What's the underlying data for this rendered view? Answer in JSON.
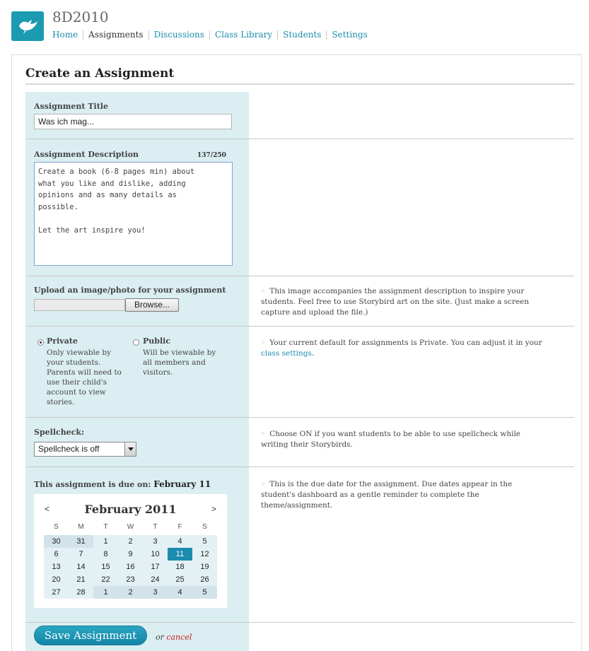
{
  "header": {
    "class_title": "8D2010",
    "nav": [
      {
        "label": "Home",
        "current": false
      },
      {
        "label": "Assignments",
        "current": true
      },
      {
        "label": "Discussions",
        "current": false
      },
      {
        "label": "Class Library",
        "current": false
      },
      {
        "label": "Students",
        "current": false
      },
      {
        "label": "Settings",
        "current": false
      }
    ]
  },
  "page_title": "Create an Assignment",
  "form": {
    "title_label": "Assignment Title",
    "title_value": "Was ich mag...",
    "desc_label": "Assignment Description",
    "desc_counter": "137/250",
    "desc_value": "Create a book (6-8 pages min) about\nwhat you like and dislike, adding\nopinions and as many details as\npossible.\n\nLet the art inspire you!",
    "upload_label": "Upload an image/photo for your assignment",
    "browse_label": "Browse...",
    "upload_help": "This image accompanies the assignment description to inspire your students. Feel free to use Storybird art on the site. (Just make a screen capture and upload the file.)",
    "private_title": "Private",
    "private_desc": "Only viewable by your students. Parents will need to use their child's account to view stories.",
    "public_title": "Public",
    "public_desc": "Will be viewable by all members and visitors.",
    "privacy_help_prefix": "Your current default for assignments is Private. You can adjust it in your",
    "privacy_help_link": "class settings",
    "privacy_help_suffix": ".",
    "spell_label": "Spellcheck:",
    "spell_value": "Spellcheck is off",
    "spell_help": "Choose ON if you want students to be able to use spellcheck while writing their Storybirds.",
    "due_prefix": "This assignment is due on:",
    "due_date": "February 11",
    "due_help": "This is the due date for the assignment. Due dates appear in the student's dashboard as a gentle reminder to complete the theme/assignment.",
    "save_label": "Save Assignment",
    "or_label": "or",
    "cancel_label": "cancel"
  },
  "calendar": {
    "month_label": "February 2011",
    "prev": "<",
    "next": ">",
    "dow": [
      "S",
      "M",
      "T",
      "W",
      "T",
      "F",
      "S"
    ],
    "weeks": [
      [
        {
          "d": "30",
          "o": true
        },
        {
          "d": "31",
          "o": true
        },
        {
          "d": "1"
        },
        {
          "d": "2"
        },
        {
          "d": "3"
        },
        {
          "d": "4"
        },
        {
          "d": "5"
        }
      ],
      [
        {
          "d": "6"
        },
        {
          "d": "7"
        },
        {
          "d": "8"
        },
        {
          "d": "9"
        },
        {
          "d": "10"
        },
        {
          "d": "11",
          "s": true
        },
        {
          "d": "12"
        }
      ],
      [
        {
          "d": "13"
        },
        {
          "d": "14"
        },
        {
          "d": "15"
        },
        {
          "d": "16"
        },
        {
          "d": "17"
        },
        {
          "d": "18"
        },
        {
          "d": "19"
        }
      ],
      [
        {
          "d": "20"
        },
        {
          "d": "21"
        },
        {
          "d": "22"
        },
        {
          "d": "23"
        },
        {
          "d": "24"
        },
        {
          "d": "25"
        },
        {
          "d": "26"
        }
      ],
      [
        {
          "d": "27"
        },
        {
          "d": "28"
        },
        {
          "d": "1",
          "o": true
        },
        {
          "d": "2",
          "o": true
        },
        {
          "d": "3",
          "o": true
        },
        {
          "d": "4",
          "o": true
        },
        {
          "d": "5",
          "o": true
        }
      ]
    ]
  },
  "icons": {
    "logo": "bird-icon"
  },
  "colors": {
    "accent": "#1b9ab1",
    "panel": "#dbeef1",
    "link": "#1b8cae",
    "cancel": "#cc2222"
  }
}
